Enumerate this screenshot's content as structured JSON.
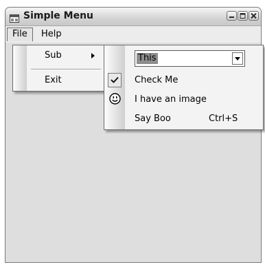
{
  "window": {
    "title": "Simple Menu",
    "icon": "app-window-icon",
    "caption_buttons": [
      "minimize-icon",
      "maximize-icon",
      "close-icon"
    ]
  },
  "menubar": {
    "items": [
      {
        "label": "File"
      },
      {
        "label": "Help"
      }
    ]
  },
  "file_menu": {
    "items": [
      {
        "label": "Sub",
        "has_submenu": true
      },
      {
        "label": "Exit"
      }
    ]
  },
  "sub_menu": {
    "combo": {
      "value": "This"
    },
    "items": [
      {
        "label": "Check Me",
        "checked": true
      },
      {
        "label": "I have an image",
        "icon": "smiley-icon"
      },
      {
        "label": "Say Boo",
        "shortcut": "Ctrl+S"
      }
    ]
  }
}
